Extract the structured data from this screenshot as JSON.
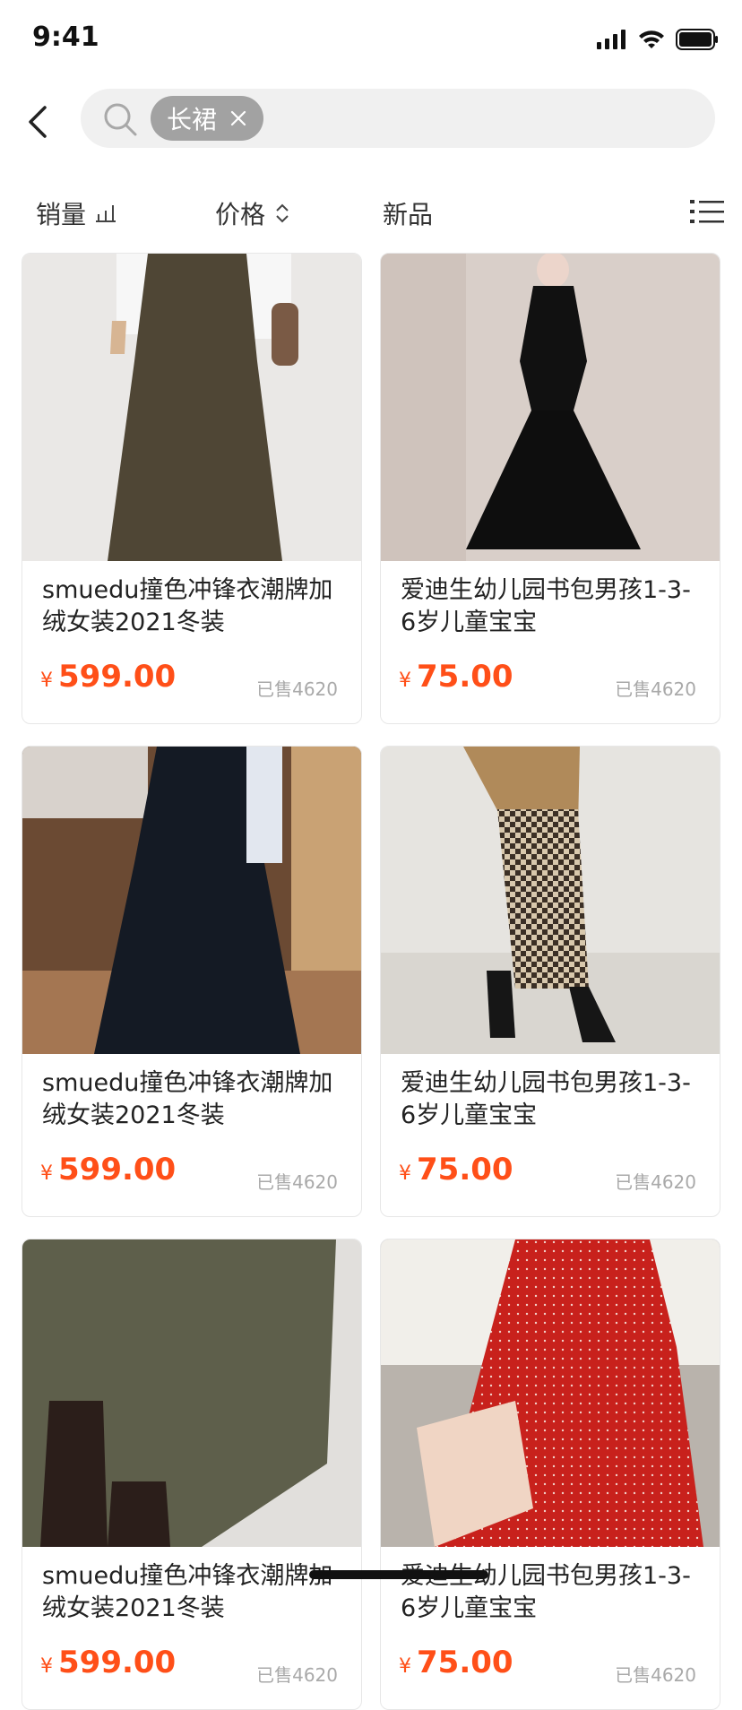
{
  "status_bar": {
    "time": "9:41"
  },
  "search": {
    "chip_label": "长裙"
  },
  "sort_bar": {
    "sales_label": "销量",
    "price_label": "价格",
    "new_label": "新品"
  },
  "products": [
    {
      "title": "smuedu撞色冲锋衣潮牌加绒女装2021冬装",
      "currency": "¥",
      "price": "599.00",
      "sold": "已售4620",
      "image": "brown-long-skirt"
    },
    {
      "title": "爱迪生幼儿园书包男孩1-3-6岁儿童宝宝",
      "currency": "¥",
      "price": "75.00",
      "sold": "已售4620",
      "image": "black-velvet-dress"
    },
    {
      "title": "smuedu撞色冲锋衣潮牌加绒女装2021冬装",
      "currency": "¥",
      "price": "599.00",
      "sold": "已售4620",
      "image": "black-long-skirt"
    },
    {
      "title": "爱迪生幼儿园书包男孩1-3-6岁儿童宝宝",
      "currency": "¥",
      "price": "75.00",
      "sold": "已售4620",
      "image": "checkered-skirt"
    },
    {
      "title": "smuedu撞色冲锋衣潮牌加绒女装2021冬装",
      "currency": "¥",
      "price": "599.00",
      "sold": "已售4620",
      "image": "olive-knit-skirt"
    },
    {
      "title": "爱迪生幼儿园书包男孩1-3-6岁儿童宝宝",
      "currency": "¥",
      "price": "75.00",
      "sold": "已售4620",
      "image": "red-polka-dress"
    }
  ],
  "colors": {
    "price": "#ff4f18",
    "chip_bg": "#a2a2a2",
    "search_bg": "#f0f0f0"
  }
}
